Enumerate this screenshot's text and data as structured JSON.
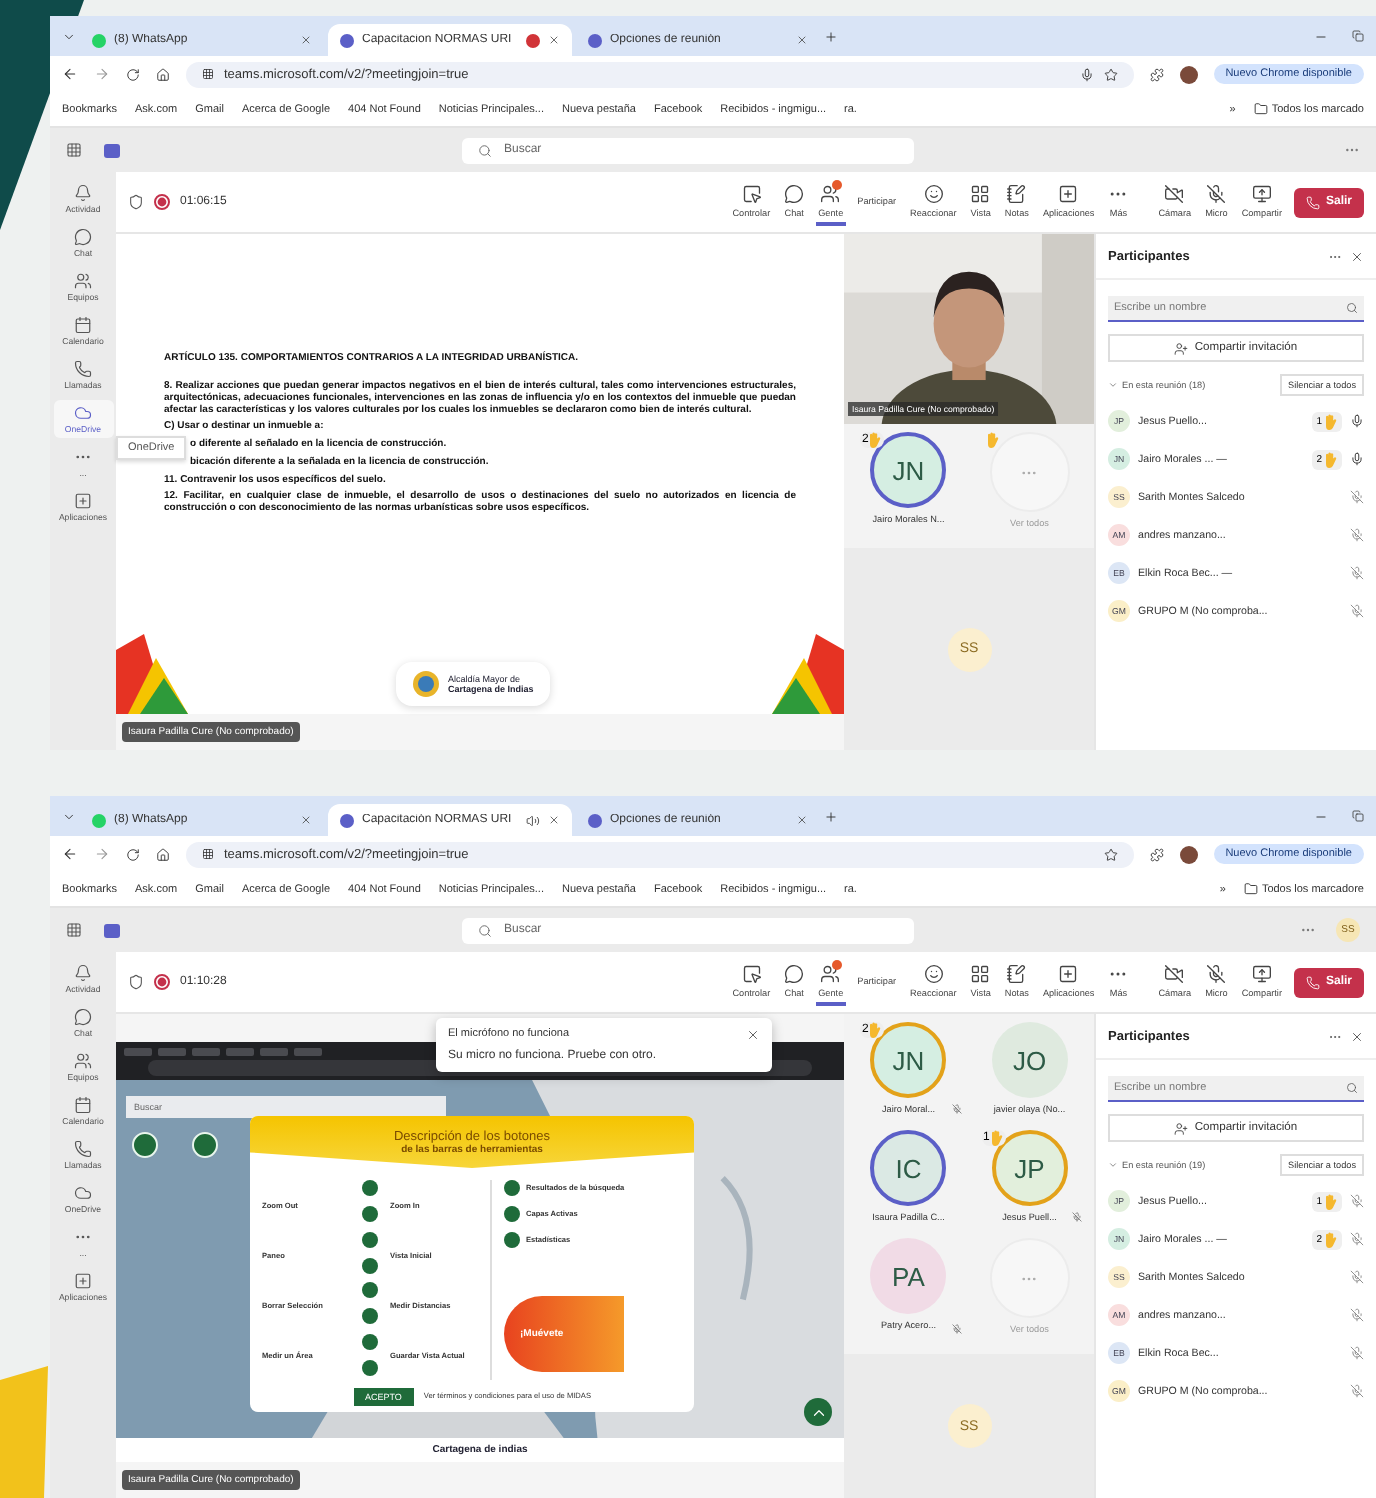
{
  "screens": [
    {
      "browser_tabs": [
        {
          "label": "(8) WhatsApp",
          "kind": "whatsapp",
          "selected": false
        },
        {
          "label": "Capacitacion NORMAS URI",
          "kind": "recording",
          "selected": true
        },
        {
          "label": "Opciones de reunión",
          "kind": "teams",
          "selected": false
        }
      ],
      "url": "teams.microsoft.com/v2/?meetingjoin=true",
      "mic_in_address": true,
      "update_pill": "Nuevo Chrome disponible",
      "bookmarks": [
        "Bookmarks",
        "Ask.com",
        "Gmail",
        "Acerca de Google",
        "404 Not Found",
        "Noticias Principales...",
        "Nueva pestaña",
        "Facebook",
        "Recibidos - ingmigu...",
        "ra."
      ],
      "more_bookmarks": "»",
      "all_bookmarks": "Todos los marcado",
      "search_placeholder": "Buscar",
      "rail": [
        {
          "label": "Actividad",
          "kind": "bell",
          "selected": false
        },
        {
          "label": "Chat",
          "kind": "chat",
          "selected": false
        },
        {
          "label": "Equipos",
          "kind": "teams",
          "selected": false
        },
        {
          "label": "Calendario",
          "kind": "calendar",
          "selected": false
        },
        {
          "label": "Llamadas",
          "kind": "calls",
          "selected": false
        },
        {
          "label": "OneDrive",
          "kind": "cloud",
          "selected": true
        },
        {
          "label": "...",
          "kind": "more",
          "selected": false
        },
        {
          "label": "Aplicaciones",
          "kind": "apps",
          "selected": false
        }
      ],
      "rail_tooltip": "OneDrive",
      "timer": "01:06:15",
      "tools": [
        {
          "label": "Controlar",
          "kind": "control",
          "selected": false
        },
        {
          "label": "Chat",
          "kind": "chat",
          "selected": false
        },
        {
          "label": "Gente",
          "kind": "people",
          "selected": true
        },
        {
          "label": "Participar",
          "kind": "raise",
          "selected": false
        },
        {
          "label": "Reaccionar",
          "kind": "react",
          "selected": false
        },
        {
          "label": "Vista",
          "kind": "view",
          "selected": false
        },
        {
          "label": "Notas",
          "kind": "notes",
          "selected": false
        },
        {
          "label": "Aplicaciones",
          "kind": "apps",
          "selected": false
        },
        {
          "label": "Más",
          "kind": "more",
          "selected": false
        },
        {
          "label": "Cámara",
          "kind": "camera",
          "selected": false
        },
        {
          "label": "Micro",
          "kind": "mic",
          "selected": false
        },
        {
          "label": "Compartir",
          "kind": "share",
          "selected": false
        }
      ],
      "leave": "Salir",
      "content": {
        "kind": "slide",
        "title": "ARTÍCULO 135. COMPORTAMIENTOS CONTRARIOS A LA INTEGRIDAD URBANÍSTICA.",
        "paragraphs": [
          {
            "text": "8. Realizar acciones que puedan generar impactos negativos en el bien de interés cultural, tales como intervenciones estructurales, arquitectónicas, adecuaciones funcionales, intervenciones en las zonas de influencia y/o en los contextos del inmueble que puedan afectar las características y los valores culturales por los cuales los inmuebles se declararon como bien de interés cultural.",
            "covered": false
          },
          {
            "text": "C) Usar o destinar un inmueble a:",
            "covered": false
          },
          {
            "text": "o diferente al señalado en la licencia de construcción.",
            "covered": true
          },
          {
            "text": "bicación diferente a la señalada en la licencia de construcción.",
            "covered": true
          },
          {
            "text": "11. Contravenir los usos específicos del suelo.",
            "covered": false
          },
          {
            "text": "12. Facilitar, en cualquier clase de inmueble, el desarrollo de usos o destinaciones del suelo no autorizados en licencia de construcción o con desconocimiento de las normas urbanísticas sobre usos específicos.",
            "covered": false
          }
        ],
        "logo_lines": [
          "Alcaldía Mayor de",
          "Cartagena de Indias"
        ]
      },
      "presenter": "Isaura Padilla Cure (No comprobado)",
      "tiles": [
        {
          "kind": "video",
          "label": "Isaura Padilla Cure (No comprobado)"
        },
        {
          "kind": "avatar",
          "initials": "JN",
          "label": "Jairo Morales N...",
          "hand": "2",
          "speaking": true,
          "muted": false,
          "color": "#d5eee2"
        },
        {
          "kind": "more",
          "label": "Ver todos",
          "hand_icon": true
        }
      ],
      "bottom_tile": "SS",
      "panel": {
        "title": "Participantes",
        "search_placeholder": "Escribe un nombre",
        "invite": "Compartir invitación",
        "section": "En esta reunión (18)",
        "mute_all": "Silenciar a todos",
        "people": [
          {
            "initials": "JP",
            "name": "Jesus Puello...",
            "color": "#e2efdc",
            "hand": "1",
            "muted": false
          },
          {
            "initials": "JN",
            "name": "Jairo Morales ... —",
            "color": "#d5eee2",
            "hand": "2",
            "muted": false
          },
          {
            "initials": "SS",
            "name": "Sarith Montes Salcedo",
            "color": "#fbefcf",
            "muted": true
          },
          {
            "initials": "AM",
            "name": "andres manzano...",
            "color": "#f9dede",
            "muted": true
          },
          {
            "initials": "EB",
            "name": "Elkin Roca Bec... —",
            "color": "#dce6f5",
            "muted": true
          },
          {
            "initials": "GM",
            "name": "GRUPO M (No comproba...",
            "color": "#fbefc8",
            "muted": true
          }
        ]
      }
    },
    {
      "browser_tabs": [
        {
          "label": "(8) WhatsApp",
          "kind": "whatsapp",
          "selected": false
        },
        {
          "label": "Capacitación NORMAS URI",
          "kind": "audio",
          "selected": true
        },
        {
          "label": "Opciones de reunión",
          "kind": "teams",
          "selected": false
        }
      ],
      "url": "teams.microsoft.com/v2/?meetingjoin=true",
      "mic_in_address": false,
      "update_pill": "Nuevo Chrome disponible",
      "bookmarks": [
        "Bookmarks",
        "Ask.com",
        "Gmail",
        "Acerca de Google",
        "404 Not Found",
        "Noticias Principales...",
        "Nueva pestaña",
        "Facebook",
        "Recibidos - ingmigu...",
        "ra."
      ],
      "more_bookmarks": "»",
      "all_bookmarks": "Todos los marcadore",
      "search_placeholder": "Buscar",
      "user_initials": "SS",
      "rail": [
        {
          "label": "Actividad",
          "kind": "bell",
          "selected": false
        },
        {
          "label": "Chat",
          "kind": "chat",
          "selected": false
        },
        {
          "label": "Equipos",
          "kind": "teams",
          "selected": false
        },
        {
          "label": "Calendario",
          "kind": "calendar",
          "selected": false
        },
        {
          "label": "Llamadas",
          "kind": "calls",
          "selected": false
        },
        {
          "label": "OneDrive",
          "kind": "cloud",
          "selected": false
        },
        {
          "label": "...",
          "kind": "more",
          "selected": false
        },
        {
          "label": "Aplicaciones",
          "kind": "apps",
          "selected": false
        }
      ],
      "timer": "01:10:28",
      "tools": [
        {
          "label": "Controlar",
          "kind": "control",
          "selected": false
        },
        {
          "label": "Chat",
          "kind": "chat",
          "selected": false
        },
        {
          "label": "Gente",
          "kind": "people",
          "selected": true
        },
        {
          "label": "Participar",
          "kind": "raise",
          "selected": false
        },
        {
          "label": "Reaccionar",
          "kind": "react",
          "selected": false
        },
        {
          "label": "Vista",
          "kind": "view",
          "selected": false
        },
        {
          "label": "Notas",
          "kind": "notes",
          "selected": false
        },
        {
          "label": "Aplicaciones",
          "kind": "apps",
          "selected": false
        },
        {
          "label": "Más",
          "kind": "more",
          "selected": false
        },
        {
          "label": "Cámara",
          "kind": "camera",
          "selected": false
        },
        {
          "label": "Micro",
          "kind": "mic",
          "selected": false
        },
        {
          "label": "Compartir",
          "kind": "share",
          "selected": false
        }
      ],
      "leave": "Salir",
      "content": {
        "kind": "shared-screen",
        "map_search": "Buscar",
        "dialog": {
          "title": "Descripción de los botones",
          "subtitle": "de las barras de herramientas",
          "left": [
            "Zoom Out",
            "Paneo",
            "Borrar Selección",
            "Medir un Área"
          ],
          "middle": [
            "Zoom In",
            "Vista Inicial",
            "Medir Distancias",
            "Guardar Vista Actual"
          ],
          "right": [
            "Resultados de la búsqueda",
            "Capas Activas",
            "Estadísticas"
          ],
          "promo": "¡Muévete",
          "accept": "ACEPTO",
          "terms": "Ver términos y condiciones para el uso de MIDAS"
        },
        "footer": "Cartagena de indias"
      },
      "toast": {
        "title": "El micrófono no funciona",
        "body": "Su micro no funciona. Pruebe con otro."
      },
      "presenter": "Isaura Padilla Cure (No comprobado)",
      "tiles": [
        {
          "kind": "avatar",
          "initials": "JN",
          "label": "Jairo Moral...",
          "hand": "2",
          "speaking": false,
          "muted": true,
          "color": "#d5eee2"
        },
        {
          "kind": "avatar",
          "initials": "JO",
          "label": "javier olaya (No...",
          "speaking": false,
          "muted": false,
          "color": "#dfeadf"
        },
        {
          "kind": "avatar",
          "initials": "IC",
          "label": "Isaura Padilla C...",
          "speaking": true,
          "muted": false,
          "color": "#dbe9e4"
        },
        {
          "kind": "avatar",
          "initials": "JP",
          "label": "Jesus Puell...",
          "hand": "1",
          "speaking": false,
          "muted": true,
          "color": "#e2efdc"
        },
        {
          "kind": "avatar",
          "initials": "PA",
          "label": "Patry Acero...",
          "speaking": false,
          "muted": true,
          "color": "#f1dbe6"
        },
        {
          "kind": "more",
          "label": "Ver todos",
          "hand_icon": false
        }
      ],
      "bottom_tile": "SS",
      "panel": {
        "title": "Participantes",
        "search_placeholder": "Escribe un nombre",
        "invite": "Compartir invitación",
        "section": "En esta reunión (19)",
        "mute_all": "Silenciar a todos",
        "people": [
          {
            "initials": "JP",
            "name": "Jesus Puello...",
            "color": "#e2efdc",
            "hand": "1",
            "muted": true
          },
          {
            "initials": "JN",
            "name": "Jairo Morales ... —",
            "color": "#d5eee2",
            "hand": "2",
            "muted": true
          },
          {
            "initials": "SS",
            "name": "Sarith Montes Salcedo",
            "color": "#fbefcf",
            "muted": true
          },
          {
            "initials": "AM",
            "name": "andres manzano...",
            "color": "#f9dede",
            "muted": true
          },
          {
            "initials": "EB",
            "name": "Elkin Roca Bec...",
            "color": "#dce6f5",
            "muted": true
          },
          {
            "initials": "GM",
            "name": "GRUPO M (No comproba...",
            "color": "#fbefc8",
            "muted": true
          }
        ]
      }
    }
  ]
}
